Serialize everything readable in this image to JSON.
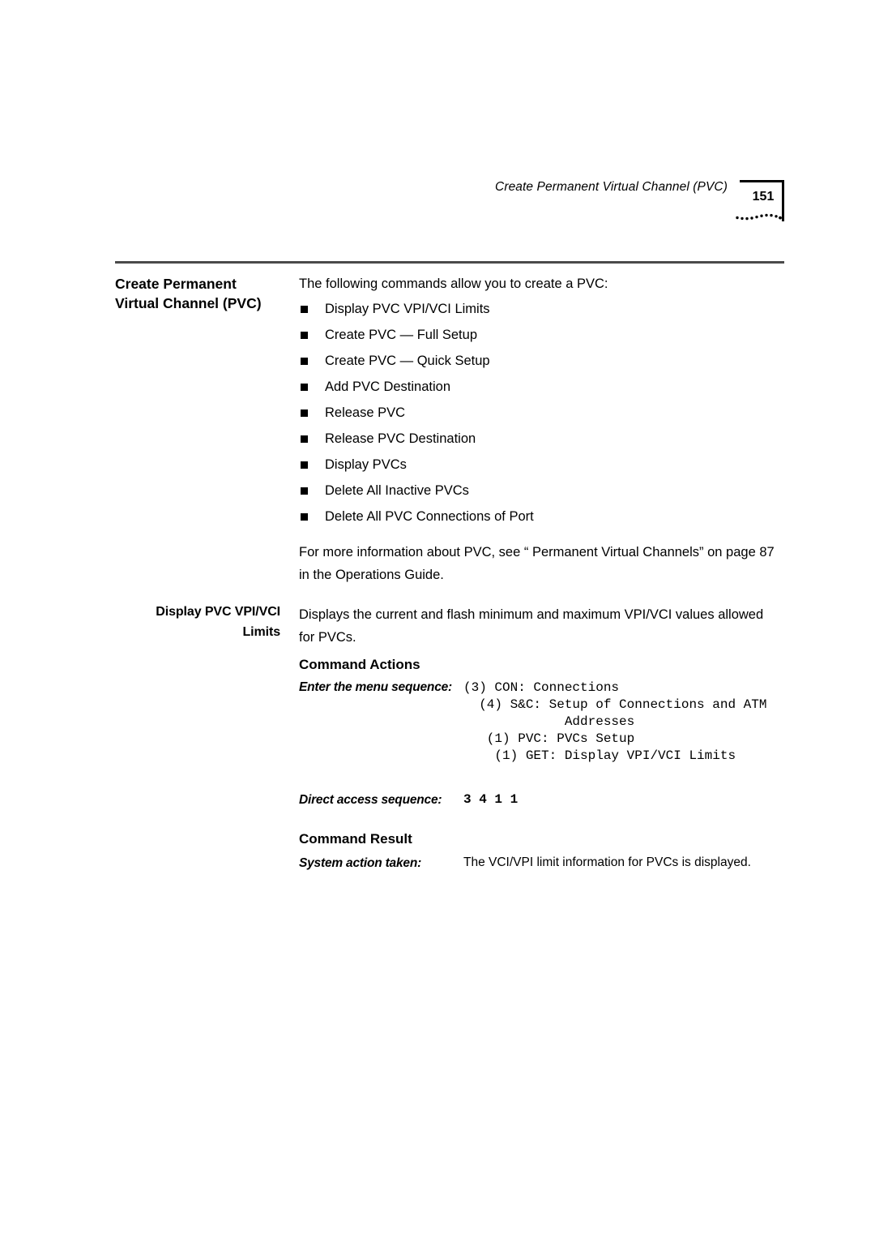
{
  "header": {
    "title": "Create Permanent Virtual Channel (PVC)",
    "page_number": "151"
  },
  "section": {
    "heading": "Create Permanent Virtual Channel (PVC)",
    "intro": "The following commands allow you to create a PVC:",
    "commands": [
      "Display PVC VPI/VCI Limits",
      "Create PVC — Full Setup",
      "Create PVC — Quick Setup",
      "Add PVC Destination",
      "Release PVC",
      "Release PVC Destination",
      "Display PVCs",
      "Delete All Inactive PVCs",
      "Delete All PVC Connections of Port"
    ],
    "more_info": "For more information about PVC, see “ Permanent Virtual Channels” on page 87 in the Operations Guide."
  },
  "subsection": {
    "heading": "Display PVC VPI/VCI Limits",
    "description": "Displays the current and flash minimum and maximum VPI/VCI values allowed for PVCs.",
    "command_actions": {
      "heading": "Command Actions",
      "menu_sequence_label": "Enter the menu sequence:",
      "menu_sequence": "(3) CON: Connections\n  (4) S&C: Setup of Connections and ATM\n             Addresses\n   (1) PVC: PVCs Setup\n    (1) GET: Display VPI/VCI Limits",
      "direct_access_label": "Direct access sequence:",
      "direct_access_sequence": "3 4 1 1"
    },
    "command_result": {
      "heading": "Command Result",
      "system_action_label": "System action taken:",
      "system_action": "The VCI/VPI limit information for PVCs is displayed."
    }
  },
  "icons": {
    "bullet": "square-bullet",
    "header_flourish": "dotted-arc-decoration"
  },
  "colors": {
    "text": "#000000",
    "rule": "#4a4a4a",
    "background": "#ffffff"
  }
}
